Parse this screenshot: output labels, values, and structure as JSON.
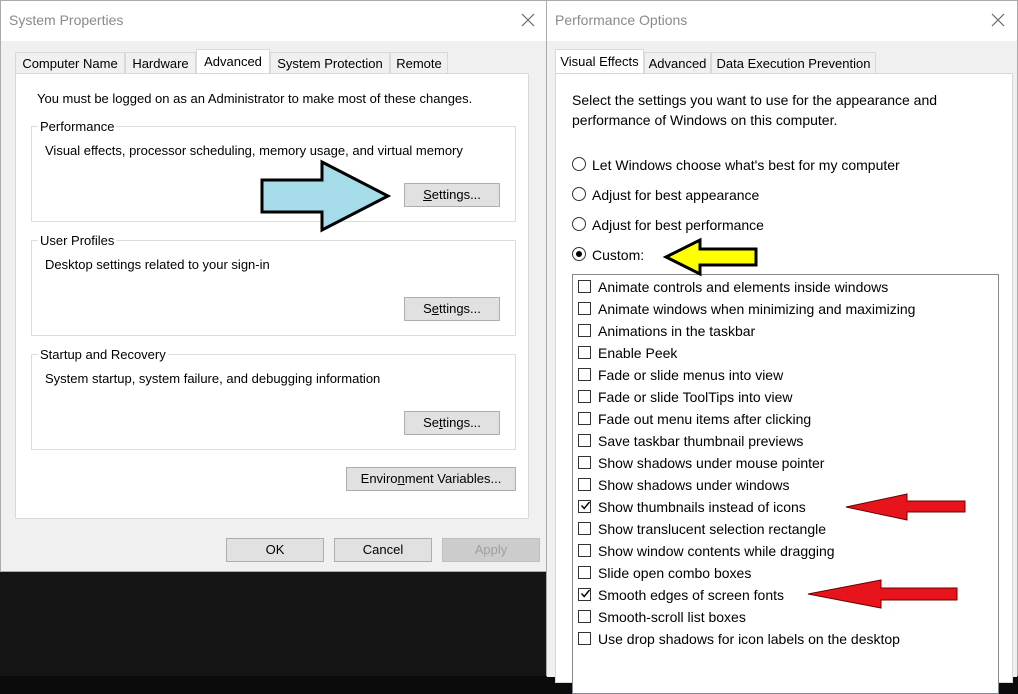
{
  "system_properties": {
    "title": "System Properties",
    "tabs": [
      "Computer Name",
      "Hardware",
      "Advanced",
      "System Protection",
      "Remote"
    ],
    "active_tab": "Advanced",
    "admin_notice": "You must be logged on as an Administrator to make most of these changes.",
    "groups": [
      {
        "label": "Performance",
        "description": "Visual effects, processor scheduling, memory usage, and virtual memory",
        "button_prefix": "",
        "button_mnemonic": "S",
        "button_suffix": "ettings..."
      },
      {
        "label": "User Profiles",
        "description": "Desktop settings related to your sign-in",
        "button_prefix": "S",
        "button_mnemonic": "e",
        "button_suffix": "ttings..."
      },
      {
        "label": "Startup and Recovery",
        "description": "System startup, system failure, and debugging information",
        "button_prefix": "Se",
        "button_mnemonic": "t",
        "button_suffix": "tings..."
      }
    ],
    "env_button": {
      "prefix": "Enviro",
      "mnemonic": "n",
      "suffix": "ment Variables..."
    },
    "footer": {
      "ok": "OK",
      "cancel": "Cancel",
      "apply": "Apply"
    }
  },
  "performance_options": {
    "title": "Performance Options",
    "tabs": [
      "Visual Effects",
      "Advanced",
      "Data Execution Prevention"
    ],
    "active_tab": "Visual Effects",
    "intro_line1": "Select the settings you want to use for the appearance and",
    "intro_line2": "performance of Windows on this computer.",
    "radios": [
      {
        "label": "Let Windows choose what's best for my computer",
        "selected": false
      },
      {
        "label": "Adjust for best appearance",
        "selected": false
      },
      {
        "label": "Adjust for best performance",
        "selected": false
      },
      {
        "label": "Custom:",
        "selected": true
      }
    ],
    "effects": [
      {
        "label": "Animate controls and elements inside windows",
        "checked": false
      },
      {
        "label": "Animate windows when minimizing and maximizing",
        "checked": false
      },
      {
        "label": "Animations in the taskbar",
        "checked": false
      },
      {
        "label": "Enable Peek",
        "checked": false
      },
      {
        "label": "Fade or slide menus into view",
        "checked": false
      },
      {
        "label": "Fade or slide ToolTips into view",
        "checked": false
      },
      {
        "label": "Fade out menu items after clicking",
        "checked": false
      },
      {
        "label": "Save taskbar thumbnail previews",
        "checked": false
      },
      {
        "label": "Show shadows under mouse pointer",
        "checked": false
      },
      {
        "label": "Show shadows under windows",
        "checked": false
      },
      {
        "label": "Show thumbnails instead of icons",
        "checked": true
      },
      {
        "label": "Show translucent selection rectangle",
        "checked": false
      },
      {
        "label": "Show window contents while dragging",
        "checked": false
      },
      {
        "label": "Slide open combo boxes",
        "checked": false
      },
      {
        "label": "Smooth edges of screen fonts",
        "checked": true
      },
      {
        "label": "Smooth-scroll list boxes",
        "checked": false
      },
      {
        "label": "Use drop shadows for icon labels on the desktop",
        "checked": false
      }
    ]
  },
  "icons": {
    "close": "close-icon",
    "checkmark": "checkmark-icon",
    "arrows": [
      "blue-arrow-icon",
      "yellow-arrow-icon",
      "red-arrow-icon"
    ]
  },
  "colors": {
    "blue_arrow": "#a6dcea",
    "yellow_arrow": "#ffff00",
    "red_arrow": "#e8141b",
    "dialog_bg": "#f0f0f0"
  }
}
